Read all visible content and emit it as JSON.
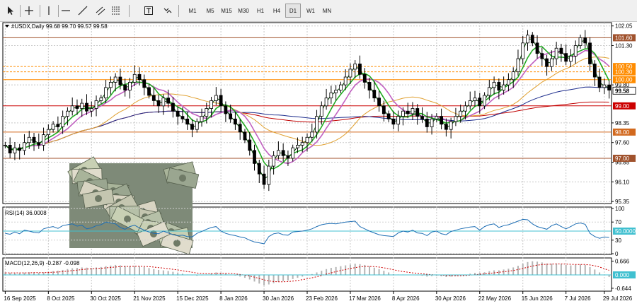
{
  "toolbar": {
    "tools": [
      {
        "icon": "cursor-arrow-icon"
      },
      {
        "icon": "crosshair-icon"
      },
      {
        "icon": "vertical-line-icon"
      },
      {
        "icon": "horizontal-line-icon"
      },
      {
        "icon": "trend-line-icon"
      },
      {
        "icon": "equidistant-channel-icon"
      },
      {
        "icon": "fibonacci-icon"
      },
      {
        "icon": "text-label-icon"
      },
      {
        "icon": "shapes-dropdown-icon"
      }
    ],
    "timeframes": [
      "M1",
      "M5",
      "M15",
      "M30",
      "H1",
      "H4",
      "D1",
      "W1",
      "MN"
    ],
    "active_timeframe": "D1"
  },
  "chart_data": [
    {
      "type": "candlestick",
      "title": "#USDX,Daily  99.68 99.70 99.57 99.58",
      "symbol": "#USDX",
      "period": "Daily",
      "ohlc_last": {
        "open": 99.68,
        "high": 99.7,
        "low": 99.57,
        "close": 99.58
      },
      "ylim": [
        95.3,
        102.15
      ],
      "y_ticks": [
        102.05,
        101.3,
        99.8,
        98.35,
        97.6,
        96.85,
        96.1,
        95.35
      ],
      "x_labels": [
        "16 Sep 2025",
        "8 Oct 2025",
        "30 Oct 2025",
        "21 Nov 2025",
        "15 Dec 2025",
        "8 Jan 2026",
        "30 Jan 2026",
        "23 Feb 2026",
        "17 Mar 2026",
        "8 Apr 2026",
        "30 Apr 2026",
        "22 May 2026",
        "15 Jun 2026",
        "7 Jul 2026",
        "29 Jul 2026"
      ],
      "close": [
        97.5,
        97.2,
        97.4,
        97.3,
        97.6,
        97.8,
        97.6,
        97.5,
        97.9,
        98.1,
        98.3,
        98.2,
        98.6,
        98.8,
        99.0,
        98.9,
        99.1,
        98.8,
        98.9,
        99.2,
        99.3,
        99.7,
        99.9,
        100.1,
        99.8,
        99.6,
        99.9,
        100.2,
        100.0,
        99.7,
        99.4,
        99.2,
        99.0,
        99.3,
        99.1,
        98.8,
        98.6,
        98.5,
        98.3,
        98.1,
        98.4,
        98.6,
        98.9,
        99.2,
        99.4,
        99.0,
        98.7,
        98.5,
        98.3,
        98.0,
        97.7,
        97.3,
        96.8,
        96.4,
        96.0,
        96.7,
        97.1,
        97.3,
        97.1,
        97.0,
        97.4,
        97.5,
        97.6,
        97.8,
        98.0,
        98.6,
        99.0,
        99.3,
        99.5,
        99.6,
        99.8,
        100.1,
        100.4,
        100.6,
        100.2,
        99.9,
        99.6,
        99.3,
        99.0,
        98.7,
        98.5,
        98.3,
        98.6,
        98.8,
        98.7,
        98.9,
        98.6,
        98.5,
        98.2,
        98.5,
        98.6,
        98.3,
        98.1,
        98.4,
        98.6,
        98.8,
        99.0,
        99.2,
        99.3,
        99.0,
        99.4,
        99.7,
        99.9,
        99.6,
        99.8,
        100.0,
        100.3,
        100.8,
        101.4,
        101.7,
        101.4,
        101.0,
        100.8,
        100.5,
        100.8,
        101.2,
        101.0,
        100.7,
        100.9,
        101.3,
        101.6,
        101.4,
        100.6,
        100.1,
        99.7,
        99.8,
        99.6
      ],
      "horizontal_levels": [
        {
          "price": 101.6,
          "label": "101.60",
          "color": "#a0522d"
        },
        {
          "price": 100.5,
          "label": "100.50",
          "color": "#ff8c00"
        },
        {
          "price": 100.3,
          "label": "100.30",
          "color": "#ff8c00"
        },
        {
          "price": 100.0,
          "label": "100.00",
          "color": "#ff8c00"
        },
        {
          "price": 99.0,
          "label": "99.00",
          "color": "#cc0000"
        },
        {
          "price": 98.0,
          "label": "98.00",
          "color": "#d2691e"
        },
        {
          "price": 97.0,
          "label": "97.00",
          "color": "#a0522d"
        }
      ],
      "price_tags": [
        {
          "price": 99.58,
          "label": "99.58",
          "bg": "#ffffff",
          "fg": "#000000"
        }
      ],
      "up_color": "#000000",
      "down_color": "#000000",
      "grid": true
    },
    {
      "type": "line",
      "title": "RSI(14) 36.0008",
      "name": "RSI(14)",
      "last_value": "36.0008",
      "ylim": [
        0,
        100
      ],
      "y_ticks": [
        100,
        70,
        30,
        0
      ],
      "levels": [
        {
          "value": 50,
          "label": "50.0000"
        }
      ],
      "color": "#1e6eb4",
      "values": [
        45,
        43,
        48,
        44,
        52,
        50,
        47,
        46,
        55,
        58,
        60,
        56,
        62,
        64,
        66,
        61,
        63,
        55,
        57,
        62,
        64,
        70,
        68,
        66,
        58,
        54,
        60,
        63,
        57,
        52,
        48,
        45,
        44,
        50,
        46,
        42,
        40,
        41,
        38,
        37,
        45,
        49,
        54,
        58,
        60,
        50,
        45,
        42,
        40,
        37,
        35,
        30,
        26,
        24,
        22,
        38,
        44,
        46,
        42,
        41,
        48,
        49,
        50,
        52,
        55,
        60,
        64,
        66,
        67,
        66,
        68,
        70,
        71,
        72,
        60,
        55,
        50,
        46,
        42,
        40,
        39,
        38,
        46,
        50,
        48,
        52,
        46,
        45,
        40,
        48,
        50,
        44,
        42,
        49,
        52,
        55,
        57,
        59,
        60,
        52,
        60,
        64,
        66,
        58,
        62,
        64,
        68,
        72,
        76,
        75,
        66,
        60,
        57,
        54,
        62,
        66,
        60,
        55,
        60,
        66,
        68,
        65,
        45,
        38,
        34,
        37,
        36
      ]
    },
    {
      "type": "histogram",
      "title": "MACD(12,26,9) -0.287 -0.098",
      "name": "MACD(12,26,9)",
      "last_values": "-0.287 -0.098",
      "ylim": [
        -0.75,
        0.75
      ],
      "y_ticks": [
        0.666,
        0.0,
        -0.644
      ],
      "levels": [
        {
          "value": 0,
          "label": "0.000"
        }
      ],
      "values": [
        0.12,
        0.1,
        0.08,
        0.09,
        0.11,
        0.13,
        0.12,
        0.1,
        0.12,
        0.15,
        0.18,
        0.2,
        0.24,
        0.28,
        0.32,
        0.34,
        0.36,
        0.35,
        0.34,
        0.36,
        0.38,
        0.42,
        0.45,
        0.48,
        0.46,
        0.44,
        0.43,
        0.44,
        0.42,
        0.38,
        0.33,
        0.28,
        0.24,
        0.22,
        0.19,
        0.15,
        0.1,
        0.06,
        0.02,
        -0.02,
        -0.04,
        -0.02,
        0.02,
        0.08,
        0.12,
        0.1,
        0.06,
        0.02,
        -0.03,
        -0.08,
        -0.14,
        -0.22,
        -0.32,
        -0.42,
        -0.5,
        -0.46,
        -0.4,
        -0.34,
        -0.3,
        -0.27,
        -0.2,
        -0.14,
        -0.08,
        -0.02,
        0.04,
        0.12,
        0.2,
        0.28,
        0.34,
        0.38,
        0.42,
        0.46,
        0.5,
        0.54,
        0.52,
        0.48,
        0.42,
        0.35,
        0.28,
        0.2,
        0.12,
        0.04,
        0.02,
        0.02,
        0.0,
        0.01,
        -0.02,
        -0.04,
        -0.08,
        -0.06,
        -0.05,
        -0.07,
        -0.1,
        -0.08,
        -0.05,
        -0.02,
        0.02,
        0.06,
        0.1,
        0.1,
        0.13,
        0.18,
        0.22,
        0.22,
        0.26,
        0.3,
        0.36,
        0.44,
        0.54,
        0.62,
        0.66,
        0.64,
        0.6,
        0.55,
        0.54,
        0.55,
        0.52,
        0.48,
        0.46,
        0.48,
        0.5,
        0.48,
        0.38,
        0.26,
        0.12,
        0.0,
        -0.1
      ],
      "bar_color": "#b4b4b4",
      "signal_color": "#cc0000",
      "signal": [
        0.1,
        0.1,
        0.1,
        0.1,
        0.1,
        0.1,
        0.11,
        0.11,
        0.11,
        0.12,
        0.13,
        0.14,
        0.16,
        0.18,
        0.21,
        0.23,
        0.26,
        0.28,
        0.29,
        0.31,
        0.32,
        0.34,
        0.36,
        0.38,
        0.4,
        0.41,
        0.41,
        0.42,
        0.42,
        0.41,
        0.4,
        0.38,
        0.35,
        0.33,
        0.3,
        0.27,
        0.24,
        0.2,
        0.16,
        0.13,
        0.09,
        0.07,
        0.06,
        0.06,
        0.07,
        0.08,
        0.08,
        0.07,
        0.05,
        0.02,
        -0.01,
        -0.05,
        -0.11,
        -0.17,
        -0.24,
        -0.29,
        -0.32,
        -0.33,
        -0.33,
        -0.32,
        -0.3,
        -0.27,
        -0.23,
        -0.19,
        -0.14,
        -0.09,
        -0.03,
        0.04,
        0.1,
        0.16,
        0.21,
        0.26,
        0.31,
        0.35,
        0.39,
        0.41,
        0.41,
        0.4,
        0.38,
        0.34,
        0.3,
        0.25,
        0.2,
        0.16,
        0.13,
        0.1,
        0.08,
        0.05,
        0.03,
        0.01,
        0.0,
        -0.01,
        -0.03,
        -0.04,
        -0.04,
        -0.04,
        -0.03,
        -0.01,
        0.01,
        0.03,
        0.05,
        0.08,
        0.1,
        0.13,
        0.15,
        0.18,
        0.21,
        0.26,
        0.31,
        0.37,
        0.43,
        0.47,
        0.5,
        0.51,
        0.52,
        0.53,
        0.53,
        0.52,
        0.51,
        0.5,
        0.5,
        0.5,
        0.48,
        0.44,
        0.38,
        0.3,
        0.22
      ]
    }
  ]
}
